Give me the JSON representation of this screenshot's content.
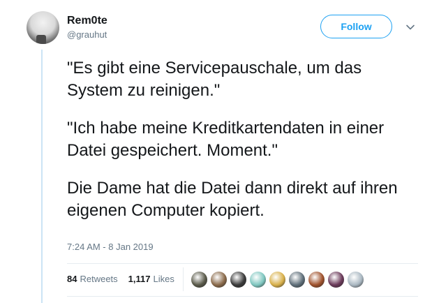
{
  "user": {
    "display_name": "Rem0te",
    "handle": "@grauhut"
  },
  "actions": {
    "follow_label": "Follow",
    "more_icon": "chevron-down-icon"
  },
  "tweet": {
    "paragraphs": [
      "\"Es gibt eine Servicepauschale, um das System zu reinigen.\"",
      "\"Ich habe meine Kreditkartendaten in einer Datei gespeichert. Moment.\"",
      "Die Dame hat die Datei dann direkt auf ihren eigenen Computer kopiert."
    ],
    "timestamp": "7:24 AM - 8 Jan 2019"
  },
  "stats": {
    "retweets_count": "84",
    "retweets_label": "Retweets",
    "likes_count": "1,117",
    "likes_label": "Likes"
  },
  "colors": {
    "accent": "#1da1f2",
    "text": "#14171a",
    "muted": "#657786",
    "thread_line": "#cce4f5"
  },
  "likers": [
    {
      "color": "#5a5a4a"
    },
    {
      "color": "#8a6a4a"
    },
    {
      "color": "#3a3a3a"
    },
    {
      "color": "#7fc7c0"
    },
    {
      "color": "#d8b04a"
    },
    {
      "color": "#5f6f7a"
    },
    {
      "color": "#a0522d"
    },
    {
      "color": "#6b3a5a"
    },
    {
      "color": "#aab8c2"
    }
  ]
}
